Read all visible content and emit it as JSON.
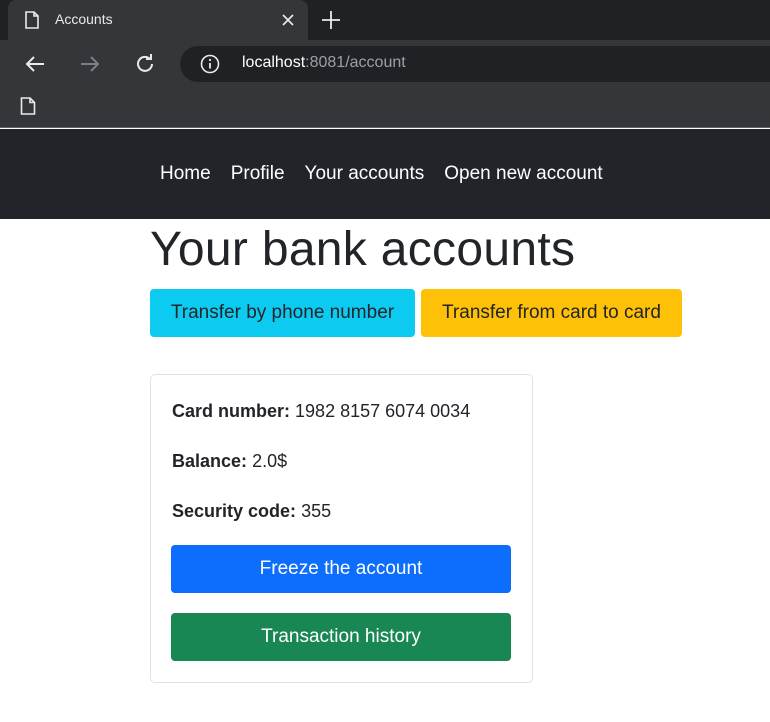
{
  "browser": {
    "tab_title": "Accounts",
    "url_host": "localhost",
    "url_rest": ":8081/account"
  },
  "nav": {
    "items": [
      "Home",
      "Profile",
      "Your accounts",
      "Open new account"
    ]
  },
  "page": {
    "title": "Your bank accounts",
    "transfer_phone_label": "Transfer by phone number",
    "transfer_card_label": "Transfer from card to card"
  },
  "account": {
    "card_number_label": "Card number:",
    "card_number": "1982 8157 6074 0034",
    "balance_label": "Balance:",
    "balance": "2.0$",
    "security_code_label": "Security code:",
    "security_code": "355",
    "freeze_label": "Freeze the account",
    "history_label": "Transaction history"
  },
  "colors": {
    "navbar": "#212529",
    "info": "#0dcaf0",
    "warning": "#ffc107",
    "primary": "#0d6efd",
    "success": "#198754"
  },
  "icons": {
    "tab": "page-icon",
    "close": "close-icon",
    "new_tab": "plus-icon",
    "back": "back-arrow-icon",
    "forward": "forward-arrow-icon",
    "reload": "reload-icon",
    "info": "info-icon",
    "bookmark": "page-icon"
  }
}
